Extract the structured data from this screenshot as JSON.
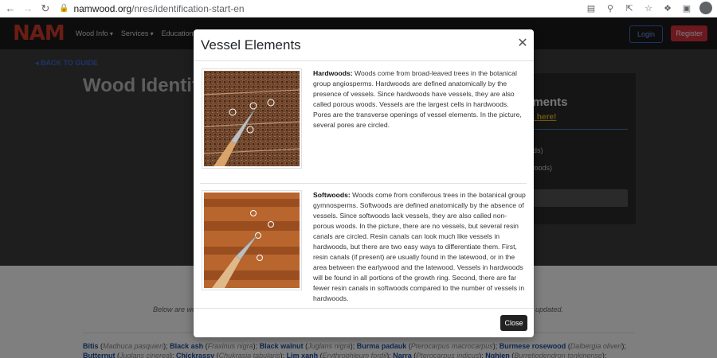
{
  "browser": {
    "url_main": "namwood.org",
    "url_path": "/nres/identification-start-en"
  },
  "site": {
    "logo": "NAM",
    "menu": [
      "Wood Info",
      "Services",
      "Education"
    ],
    "login": "Login",
    "register": "Register",
    "back_link": "BACK TO GUIDE",
    "hero_title": "Wood Identificat",
    "side_card": {
      "heading": "ements",
      "link": "ck here!",
      "line1": "ods)",
      "line2": "woods)"
    },
    "below_left": "Below are wo",
    "below_right": "y updated.",
    "species": [
      {
        "name": "Bitis",
        "latin": "Madhuca pasquieri"
      },
      {
        "name": "Black ash",
        "latin": "Fraxinus nigra"
      },
      {
        "name": "Black walnut",
        "latin": "Juglans nigra"
      },
      {
        "name": "Burma padauk",
        "latin": "Pterocarpus macrocarpus"
      },
      {
        "name": "Burmese rosewood",
        "latin": "Dalbergia oliveri"
      },
      {
        "name": "Butternut",
        "latin": "Juglans cinerea"
      },
      {
        "name": "Chickrassy",
        "latin": "Chukrasia tabularis"
      },
      {
        "name": "Lim xanh",
        "latin": "Erythrophleum fordii"
      },
      {
        "name": "Narra",
        "latin": "Pterocarpus indicus"
      },
      {
        "name": "Nghien",
        "latin": "Burretiodendron tonkinense"
      },
      {
        "name": "Pyinkado",
        "latin": "Xylia xylocarpa"
      },
      {
        "name": "Red",
        "latin": ""
      }
    ]
  },
  "modal": {
    "title": "Vessel Elements",
    "items": [
      {
        "label": "Hardwoods:",
        "text": " Woods come from broad-leaved trees in the botanical group angiosperms. Hardwoods are defined anatomically by the presence of vessels. Since hardwoods have vessels, they are also called porous woods. Vessels are the largest cells in hardwoods. Pores are the transverse openings of vessel elements. In the picture, several pores are circled."
      },
      {
        "label": "Softwoods:",
        "text": " Woods come from coniferous trees in the botanical group gymnosperms. Softwoods are defined anatomically by the absence of vessels. Since softwoods lack vessels, they are also called non-porous woods. In the picture, there are no vessels, but several resin canals are circled. Resin canals can look much like vessels in hardwoods, but there are two easy ways to differentiate them. First, resin canals (if present) are usually found in the latewood, or in the area between the earlywood and the latewood. Vessels in hardwoods will be found in all portions of the growth ring. Second, there are far fewer resin canals in softwoods compared to the number of vessels in hardwoods."
      }
    ],
    "close_button": "Close"
  }
}
